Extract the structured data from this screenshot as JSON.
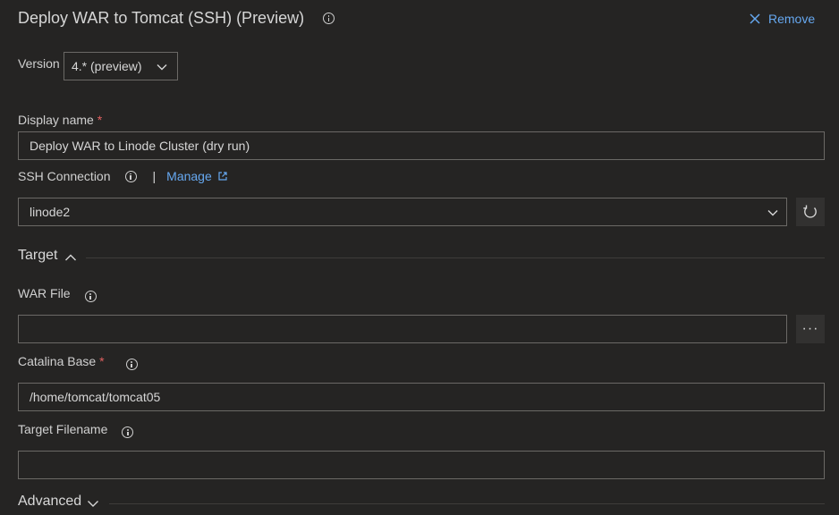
{
  "header": {
    "title": "Deploy WAR to Tomcat (SSH) (Preview)",
    "remove_label": "Remove"
  },
  "version": {
    "label": "Version",
    "value": "4.* (preview)"
  },
  "display_name": {
    "label": "Display name",
    "required_mark": "*",
    "value": "Deploy WAR to Linode Cluster (dry run)"
  },
  "ssh_connection": {
    "label": "SSH Connection",
    "separator": "|",
    "manage_label": "Manage",
    "value": "linode2"
  },
  "target_section": {
    "title": "Target",
    "war_file": {
      "label": "WAR File",
      "value": "",
      "browse_label": "···"
    },
    "catalina_base": {
      "label": "Catalina Base",
      "required_mark": "*",
      "value": "/home/tomcat/tomcat05"
    },
    "target_filename": {
      "label": "Target Filename",
      "value": ""
    }
  },
  "advanced_section": {
    "title": "Advanced"
  },
  "colors": {
    "background": "#252423",
    "link": "#66a8f0",
    "required": "#e06060",
    "border": "#6b6966"
  }
}
